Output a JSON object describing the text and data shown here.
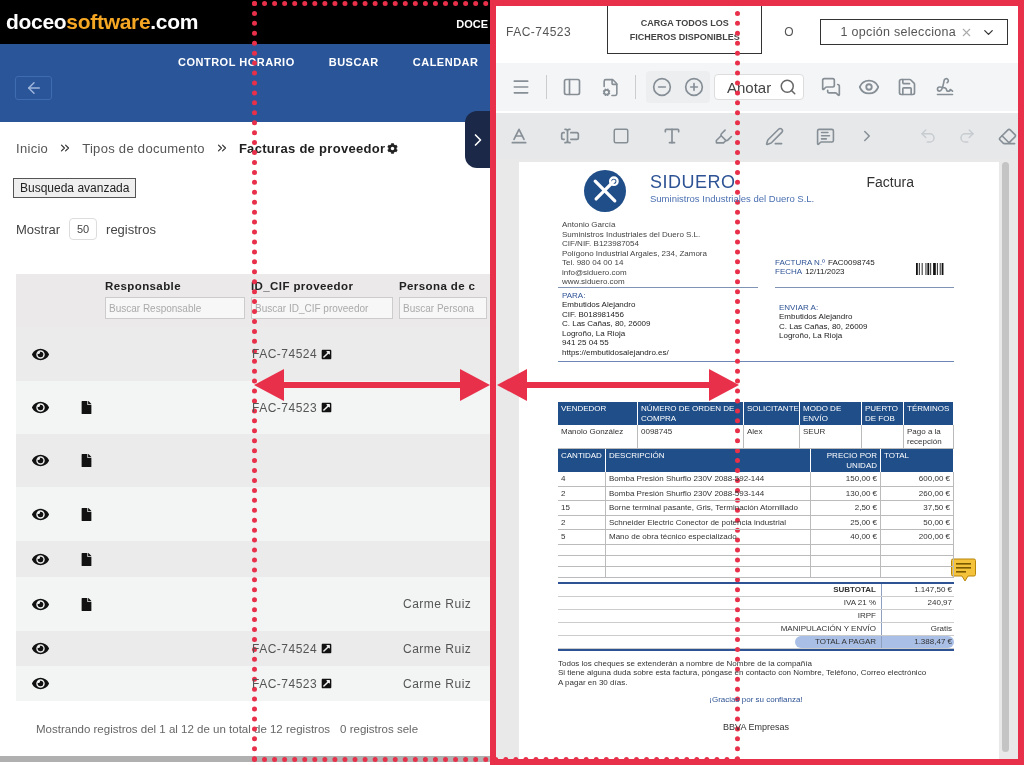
{
  "header": {
    "logo": [
      {
        "text": "doceo",
        "kind": "plain"
      },
      {
        "text": "software",
        "kind": "accent"
      },
      {
        "text": ".com",
        "kind": "plain"
      }
    ],
    "user": "DOCE"
  },
  "nav": {
    "items": [
      "CONTROL HORARIO",
      "BUSCAR",
      "CALENDAR"
    ]
  },
  "breadcrumb": [
    {
      "label": "Inicio",
      "current": false
    },
    {
      "label": "Tipos de documento",
      "current": false
    },
    {
      "label": "Facturas de proveedor",
      "current": true
    }
  ],
  "advanced_search": "Busqueda avanzada",
  "page_length": {
    "label_before": "Mostrar",
    "value": "50",
    "label_after": "registros"
  },
  "table": {
    "columns": [
      {
        "label": "Responsable",
        "placeholder": "Buscar Responsable"
      },
      {
        "label": "ID_CIF proveedor",
        "placeholder": "Buscar ID_CIF proveedor"
      },
      {
        "label": "Persona de c",
        "placeholder": "Buscar Persona"
      }
    ],
    "rows": [
      {
        "has_file": false,
        "id_cif": "FAC-74524"
      },
      {
        "has_file": true,
        "id_cif": "FAC-74523"
      },
      {
        "has_file": true
      },
      {
        "has_file": true
      },
      {
        "has_file": true
      },
      {
        "has_file": true,
        "persona": "Carme Ruiz"
      },
      {
        "has_file": false,
        "id_cif": "FAC-74524",
        "persona": "Carme Ruiz"
      },
      {
        "has_file": false,
        "id_cif": "FAC-74523",
        "persona": "Carme Ruiz"
      }
    ]
  },
  "footer": {
    "info": "Mostrando registros del 1 al 12 de un total de 12 registros",
    "selection": "0 registros sele"
  },
  "viewer": {
    "file_name": "FAC-74523",
    "load_all_button": "CARGA TODOS LOS FICHEROS DISPONIBLES",
    "or_label": "O",
    "select": {
      "value": "1 opción selecciona"
    },
    "annotate": "Anotar",
    "history": {
      "undo_enabled": false,
      "redo_enabled": false
    },
    "document": {
      "company": "SIDUERO",
      "company_full": "Suministros Industriales del Duero S.L.",
      "doc_title": "Factura",
      "sender": [
        "Antonio García",
        "Suministros Industriales del Duero S.L.",
        "CIF/NIF. B123987054",
        "Polígono Industrial Argales, 234, Zamora",
        "Tel. 980 04 00 14",
        "info@siduero.com",
        "www.siduero.com"
      ],
      "invoice_meta": [
        {
          "label": "FACTURA N.º",
          "value": "FAC0098745"
        },
        {
          "label": "FECHA",
          "value": "12/11/2023"
        }
      ],
      "bill_to": {
        "label": "PARA:",
        "lines": [
          "Embutidos Alejandro",
          "CIF. B018981456",
          "C. Las Cañas, 80, 26009",
          "Logroño, La Rioja",
          "941 25 04 55",
          "https://embutidosalejandro.es/"
        ]
      },
      "ship_to": {
        "label": "ENVIAR A:",
        "lines": [
          "Embutidos Alejandro",
          "C. Las Cañas, 80, 26009",
          "Logroño, La Rioja"
        ]
      },
      "order_table": {
        "columns": [
          "VENDEDOR",
          "NÚMERO DE ORDEN DE COMPRA",
          "SOLICITANTE",
          "MODO DE ENVÍO",
          "PUERTO DE FOB",
          "TÉRMINOS"
        ],
        "row": [
          {
            "kind": "text",
            "text": "Manolo González"
          },
          {
            "kind": "text",
            "text": "0098745"
          },
          {
            "kind": "text",
            "text": "Alex"
          },
          {
            "kind": "text",
            "text": "SEUR"
          },
          {
            "kind": "blank"
          },
          {
            "kind": "text",
            "text": "Pago a la recepción"
          }
        ]
      },
      "items_table": {
        "columns": [
          "CANTIDAD",
          "DESCRIPCIÓN",
          "PRECIO POR UNIDAD",
          "TOTAL"
        ],
        "rows": [
          {
            "kind": "item",
            "cells": [
              "4",
              "Bomba Presión Shurflo 230V 2088-592-144",
              "150,00 €",
              "600,00 €"
            ]
          },
          {
            "kind": "item",
            "cells": [
              "2",
              "Bomba Presión Shurflo 230V 2088-593-144",
              "130,00 €",
              "260,00 €"
            ]
          },
          {
            "kind": "item",
            "cells": [
              "15",
              "Borne terminal pasante, Gris, Terminación Atornillado",
              "2,50 €",
              "37,50 €"
            ]
          },
          {
            "kind": "item",
            "cells": [
              "2",
              "Schneider Electric Conector de potencia industrial",
              "25,00 €",
              "50,00 €"
            ]
          },
          {
            "kind": "item",
            "cells": [
              "5",
              "Mano de obra técnico especializado",
              "40,00 €",
              "200,00 €"
            ]
          },
          {
            "kind": "blank"
          },
          {
            "kind": "blank"
          },
          {
            "kind": "blank"
          }
        ]
      },
      "totals": [
        {
          "label": "SUBTOTAL",
          "value": "1.147,50 €",
          "highlight": false
        },
        {
          "label": "IVA 21 %",
          "value": "240,97",
          "highlight": false
        },
        {
          "label": "IRPF",
          "highlight": false
        },
        {
          "label": "MANIPULACIÓN Y ENVÍO",
          "value": "Gratis",
          "highlight": false
        },
        {
          "label": "TOTAL A PAGAR",
          "value": "1.388,47 €",
          "highlight": true
        }
      ],
      "notes": [
        "Todos los cheques se extenderán a nombre de Nombre de la compañía",
        "Si tiene alguna duda sobre esta factura, póngase en contacto con Nombre, Teléfono, Correo electrónico",
        "A pagar en 30 días."
      ],
      "thanks": "¡Gracias por su confianza!",
      "bank": "BBVA Empresas"
    }
  }
}
